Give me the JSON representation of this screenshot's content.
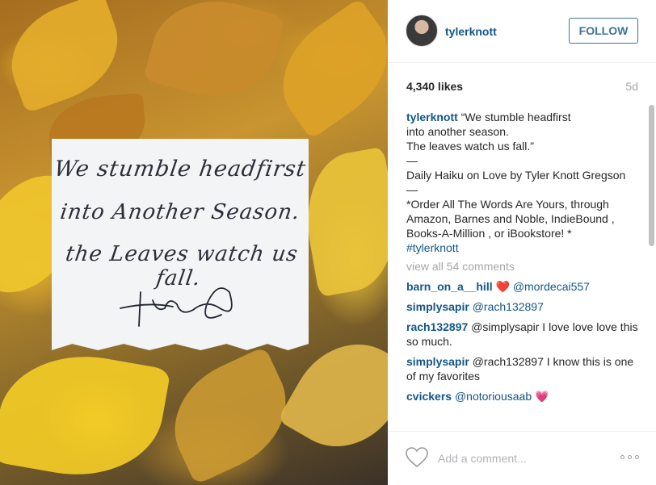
{
  "photo": {
    "note_lines": [
      "We stumble headfirst",
      "into Another Season.",
      "the Leaves watch us fall."
    ],
    "signature_icon": "signature-scribble"
  },
  "header": {
    "username": "tylerknott",
    "follow_label": "FOLLOW"
  },
  "stats": {
    "likes": "4,340 likes",
    "time": "5d"
  },
  "caption": {
    "username": "tylerknott",
    "text": "“We stumble headfirst\ninto another season.\nThe leaves watch us fall.”\n—\nDaily Haiku on Love by Tyler Knott Gregson\n—\n*Order All The Words Are Yours, through Amazon, Barnes and Noble, IndieBound , Books-A-Million , or iBookstore! *",
    "hashtag": "#tylerknott"
  },
  "view_all": "view all 54 comments",
  "comments": [
    {
      "user": "barn_on_a__hill",
      "emoji": "❤️",
      "text": "@mordecai557"
    },
    {
      "user": "simplysapir",
      "emoji": "",
      "text": "@rach132897"
    },
    {
      "user": "rach132897",
      "emoji": "",
      "text": "@simplysapir I love love love this so much."
    },
    {
      "user": "simplysapir",
      "emoji": "",
      "text": "@rach132897 I know this is one of my favorites"
    },
    {
      "user": "cvickers",
      "emoji": "💗",
      "text": "@notoriousaab"
    }
  ],
  "footer": {
    "comment_placeholder": "Add a comment...",
    "icons": {
      "like": "heart-outline-icon",
      "more": "more-options-icon"
    }
  },
  "colors": {
    "link": "#125688",
    "follow": "#3f729b",
    "muted": "#a5a7aa"
  }
}
